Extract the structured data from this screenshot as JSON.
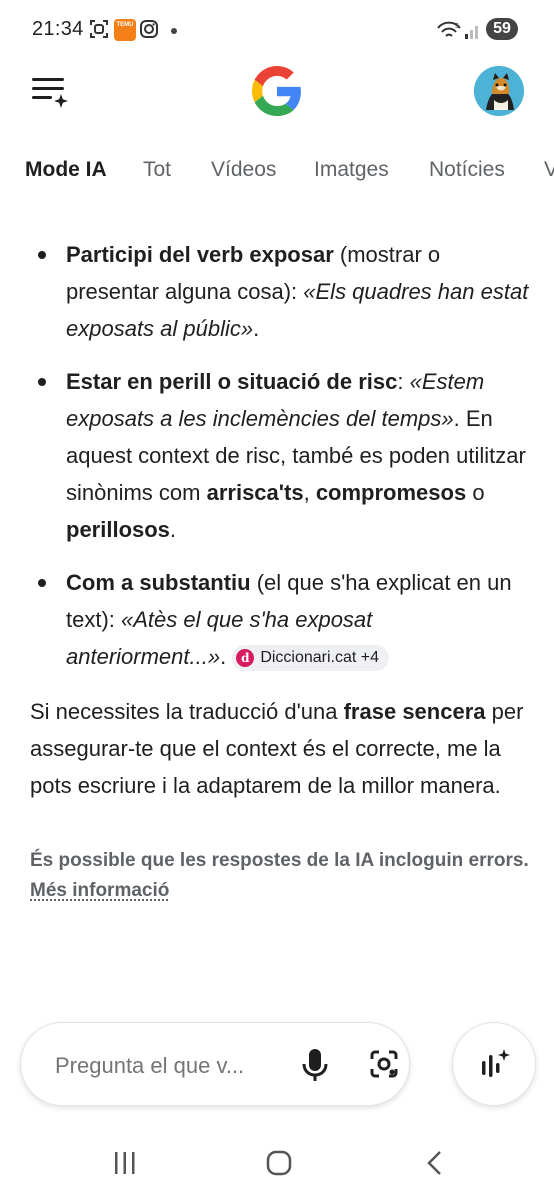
{
  "status_bar": {
    "time": "21:34",
    "battery": "59",
    "temu_label": "TEMU"
  },
  "icons": {
    "menu": "menu-sparkle-icon",
    "logo": "google-logo",
    "avatar": "profile-avatar",
    "mic": "microphone-icon",
    "lens": "google-lens-icon",
    "live": "live-voice-icon"
  },
  "tabs": [
    {
      "label": "Mode IA",
      "active": true
    },
    {
      "label": "Tot"
    },
    {
      "label": "Vídeos"
    },
    {
      "label": "Imatges"
    },
    {
      "label": "Notícies"
    },
    {
      "label": "V"
    }
  ],
  "content": {
    "items": [
      {
        "term": "Participi del verb exposar",
        "desc": " (mostrar o presentar alguna cosa): ",
        "example": "«Els quadres han estat exposats al públic»",
        "tail": "."
      },
      {
        "term": "Estar en perill o situació de risc",
        "desc": ": ",
        "example": "«Estem exposats a les inclemències del temps»",
        "tail": ". En aquest context de risc, també es poden utilitzar sinònims com ",
        "syn1": "arrisca'ts",
        "sep1": ", ",
        "syn2": "compromesos",
        "sep2": " o ",
        "syn3": "perillosos",
        "end": "."
      },
      {
        "term": "Com a substantiu",
        "desc": " (el que s'ha explicat en un text): ",
        "example": "«Atès el que s'ha exposat anteriorment...»",
        "tail": ". ",
        "chip_letter": "d",
        "chip_label": "Diccionari.cat +4"
      }
    ],
    "paragraph": {
      "before": "Si necessites la traducció d'una ",
      "bold": "frase sencera",
      "after": " per assegurar-te que el context és el correcte, me la pots escriure i la adaptarem de la millor manera."
    },
    "disclaimer": {
      "text": "És possible que les respostes de la IA incloguin errors. ",
      "link": "Més informació"
    }
  },
  "input": {
    "placeholder": "Pregunta el que v..."
  },
  "colors": {
    "accent_chip": "#d81b60",
    "text": "#1f1f1f",
    "muted": "#5f6368"
  }
}
